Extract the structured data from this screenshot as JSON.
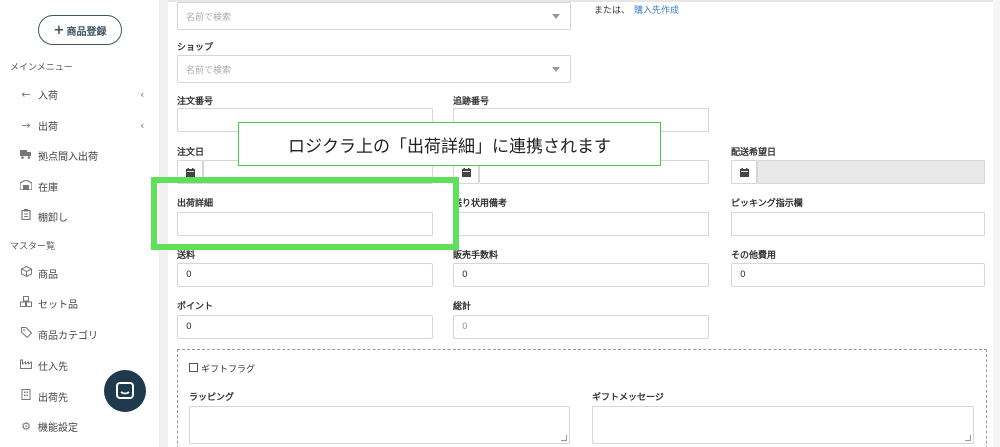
{
  "sidebar": {
    "add_button": "商品登録",
    "main_menu_label": "メインメニュー",
    "main_items": [
      {
        "label": "入荷",
        "icon": "arrow-left-icon"
      },
      {
        "label": "出荷",
        "icon": "arrow-right-icon"
      },
      {
        "label": "拠点間入出荷",
        "icon": "truck-icon"
      },
      {
        "label": "在庫",
        "icon": "warehouse-icon"
      },
      {
        "label": "棚卸し",
        "icon": "clipboard-icon"
      }
    ],
    "master_label": "マスター覧",
    "master_items": [
      {
        "label": "商品",
        "icon": "cube-icon"
      },
      {
        "label": "セット品",
        "icon": "cubes-icon"
      },
      {
        "label": "商品カテゴリ",
        "icon": "tag-icon"
      },
      {
        "label": "仕入先",
        "icon": "factory-icon"
      },
      {
        "label": "出荷先",
        "icon": "building-icon"
      },
      {
        "label": "機能設定",
        "icon": "gear-icon"
      }
    ]
  },
  "form": {
    "top_select_placeholder": "名前で検索",
    "or_text": "または、",
    "create_supplier_link": "購入先作成",
    "shop_label": "ショップ",
    "shop_placeholder": "名前で検索",
    "order_number_label": "注文番号",
    "tracking_number_label": "追跡番号",
    "order_date_label": "注文日",
    "delivery_date_label": "配送希望日",
    "shipping_detail_label": "出荷詳細",
    "invoice_note_label": "送り状用備考",
    "picking_label": "ピッキング指示欄",
    "shipping_fee_label": "送料",
    "shipping_fee_value": "0",
    "sales_fee_label": "販売手数料",
    "sales_fee_value": "0",
    "other_cost_label": "その他費用",
    "other_cost_value": "0",
    "point_label": "ポイント",
    "point_value": "0",
    "total_label": "総計",
    "total_value": "0",
    "gift_flag_label": "ギフトフラグ",
    "wrapping_label": "ラッピング",
    "gift_message_label": "ギフトメッセージ"
  },
  "overlay": {
    "tooltip_text": "ロジクラ上の「出荷詳細」に連携されます"
  },
  "colors": {
    "highlight": "#5ee05a",
    "tooltip_border": "#4cc94c",
    "link": "#3b7ec6",
    "chat_bubble": "#1f3a4d"
  }
}
